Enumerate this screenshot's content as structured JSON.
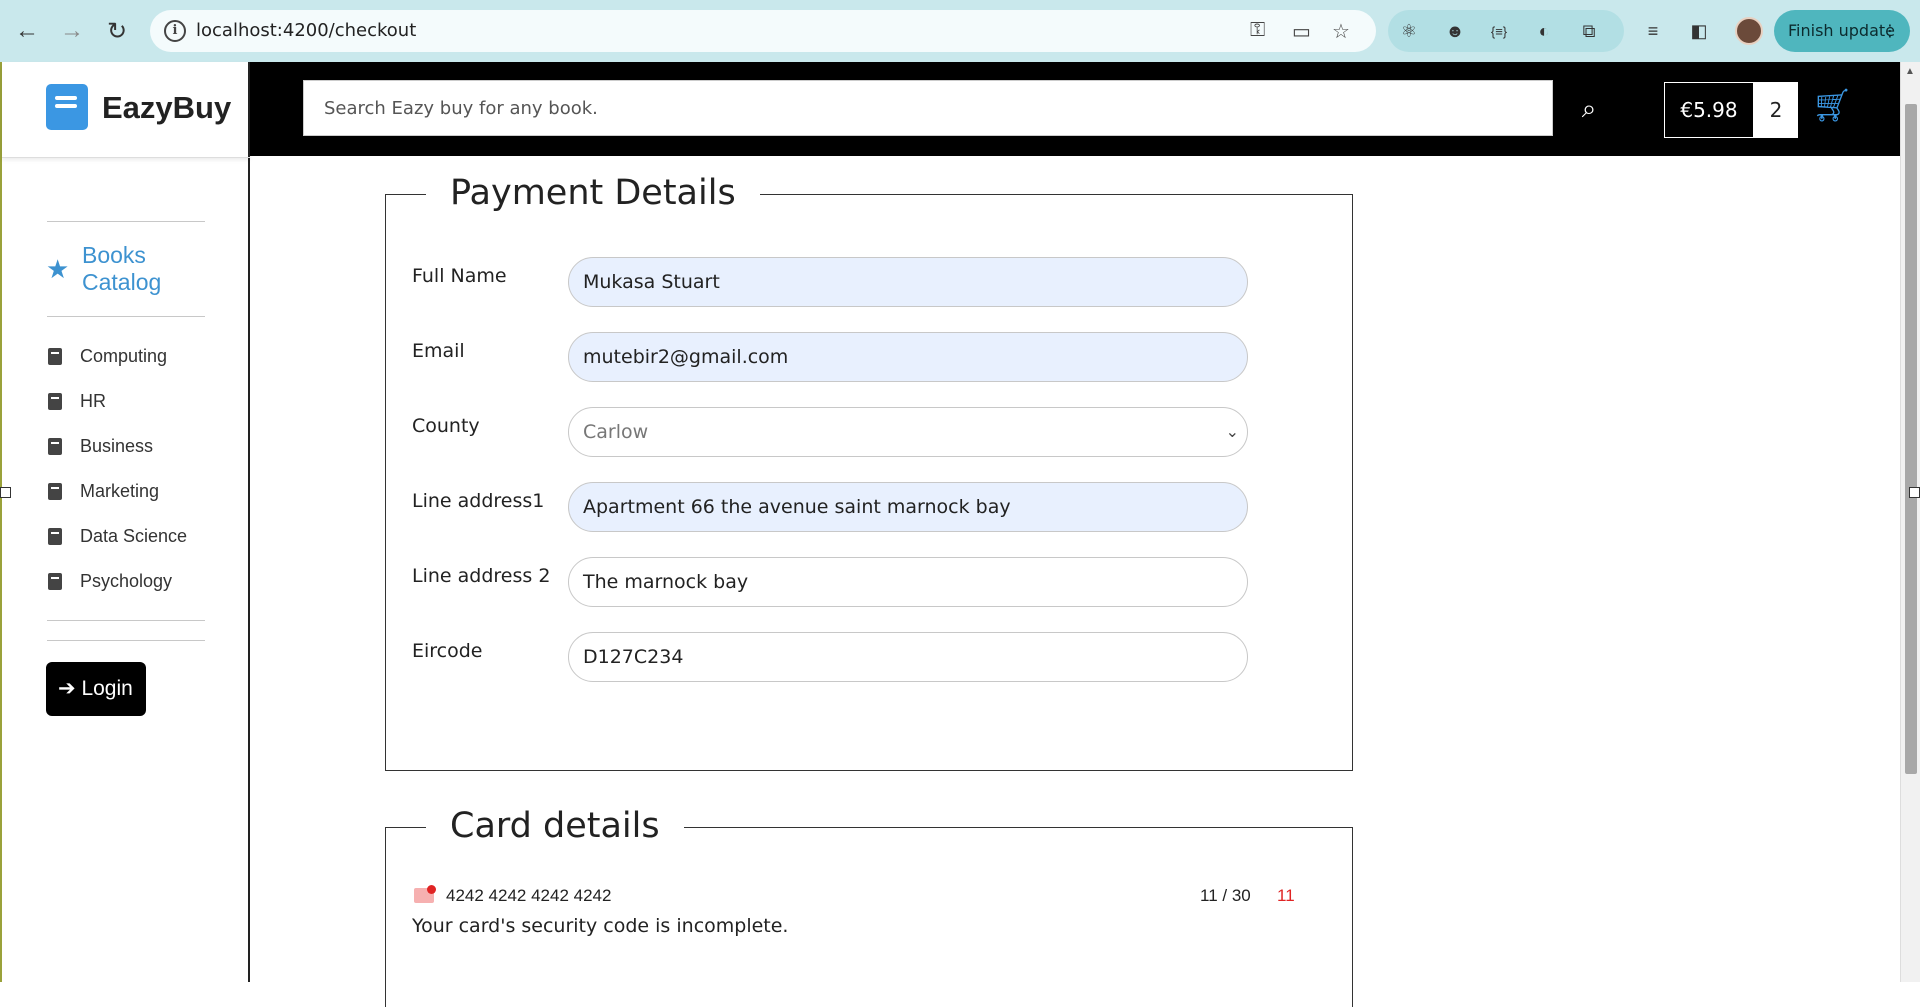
{
  "browser": {
    "url": "localhost:4200/checkout",
    "finish_update_label": "Finish update"
  },
  "sidebar": {
    "brand": "EazyBuy",
    "catalog_title": "Books Catalog",
    "categories": [
      "Computing",
      "HR",
      "Business",
      "Marketing",
      "Data Science",
      "Psychology"
    ],
    "login_label": "Login"
  },
  "topbar": {
    "search_placeholder": "Search Eazy buy for any book.",
    "cart_total": "€5.98",
    "cart_count": "2"
  },
  "payment": {
    "title": "Payment Details",
    "full_name_label": "Full Name",
    "full_name_value": "Mukasa Stuart",
    "email_label": "Email",
    "email_value": "mutebir2@gmail.com",
    "county_label": "County",
    "county_value": "Carlow",
    "line1_label": "Line address1",
    "line1_value": "Apartment 66 the avenue saint marnock bay",
    "line2_label": "Line address 2",
    "line2_value": "The marnock bay",
    "eircode_label": "Eircode",
    "eircode_value": "D127C234"
  },
  "card": {
    "title": "Card details",
    "number": "4242 4242 4242 4242",
    "expiry": "11 / 30",
    "cvc": "11",
    "error": "Your card's security code is incomplete."
  },
  "colors": {
    "accent": "#3b97e3",
    "autofill_bg": "#e8f0fe",
    "error": "#e02424"
  }
}
